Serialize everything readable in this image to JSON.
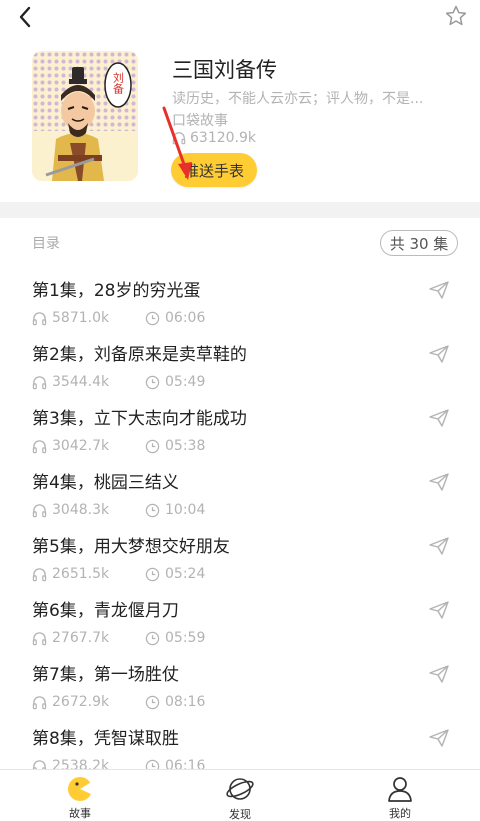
{
  "header": {
    "title": "三国刘备传",
    "description": "读历史，不能人云亦云；评人物，不是...",
    "author": "口袋故事",
    "play_count": "63120.9k",
    "push_button_label": "推送手表"
  },
  "cover": {
    "badge_text": "刘备"
  },
  "toc": {
    "label": "目录",
    "count_badge": "共 30 集"
  },
  "episodes": [
    {
      "title": "第1集，28岁的穷光蛋",
      "plays": "5871.0k",
      "duration": "06:06"
    },
    {
      "title": "第2集，刘备原来是卖草鞋的",
      "plays": "3544.4k",
      "duration": "05:49"
    },
    {
      "title": "第3集，立下大志向才能成功",
      "plays": "3042.7k",
      "duration": "05:38"
    },
    {
      "title": "第4集，桃园三结义",
      "plays": "3048.3k",
      "duration": "10:04"
    },
    {
      "title": "第5集，用大梦想交好朋友",
      "plays": "2651.5k",
      "duration": "05:24"
    },
    {
      "title": "第6集，青龙偃月刀",
      "plays": "2767.7k",
      "duration": "05:59"
    },
    {
      "title": "第7集，第一场胜仗",
      "plays": "2672.9k",
      "duration": "08:16"
    },
    {
      "title": "第8集，凭智谋取胜",
      "plays": "2538.2k",
      "duration": "06:16"
    }
  ],
  "tabbar": {
    "tabs": [
      {
        "label": "故事",
        "icon": "story-face-icon"
      },
      {
        "label": "发现",
        "icon": "planet-icon"
      },
      {
        "label": "我的",
        "icon": "user-icon"
      }
    ]
  },
  "colors": {
    "accent": "#ffcc33",
    "muted_text": "#b3b3b3",
    "divider": "#f2f2f2",
    "annotation_arrow": "#e8302a"
  }
}
